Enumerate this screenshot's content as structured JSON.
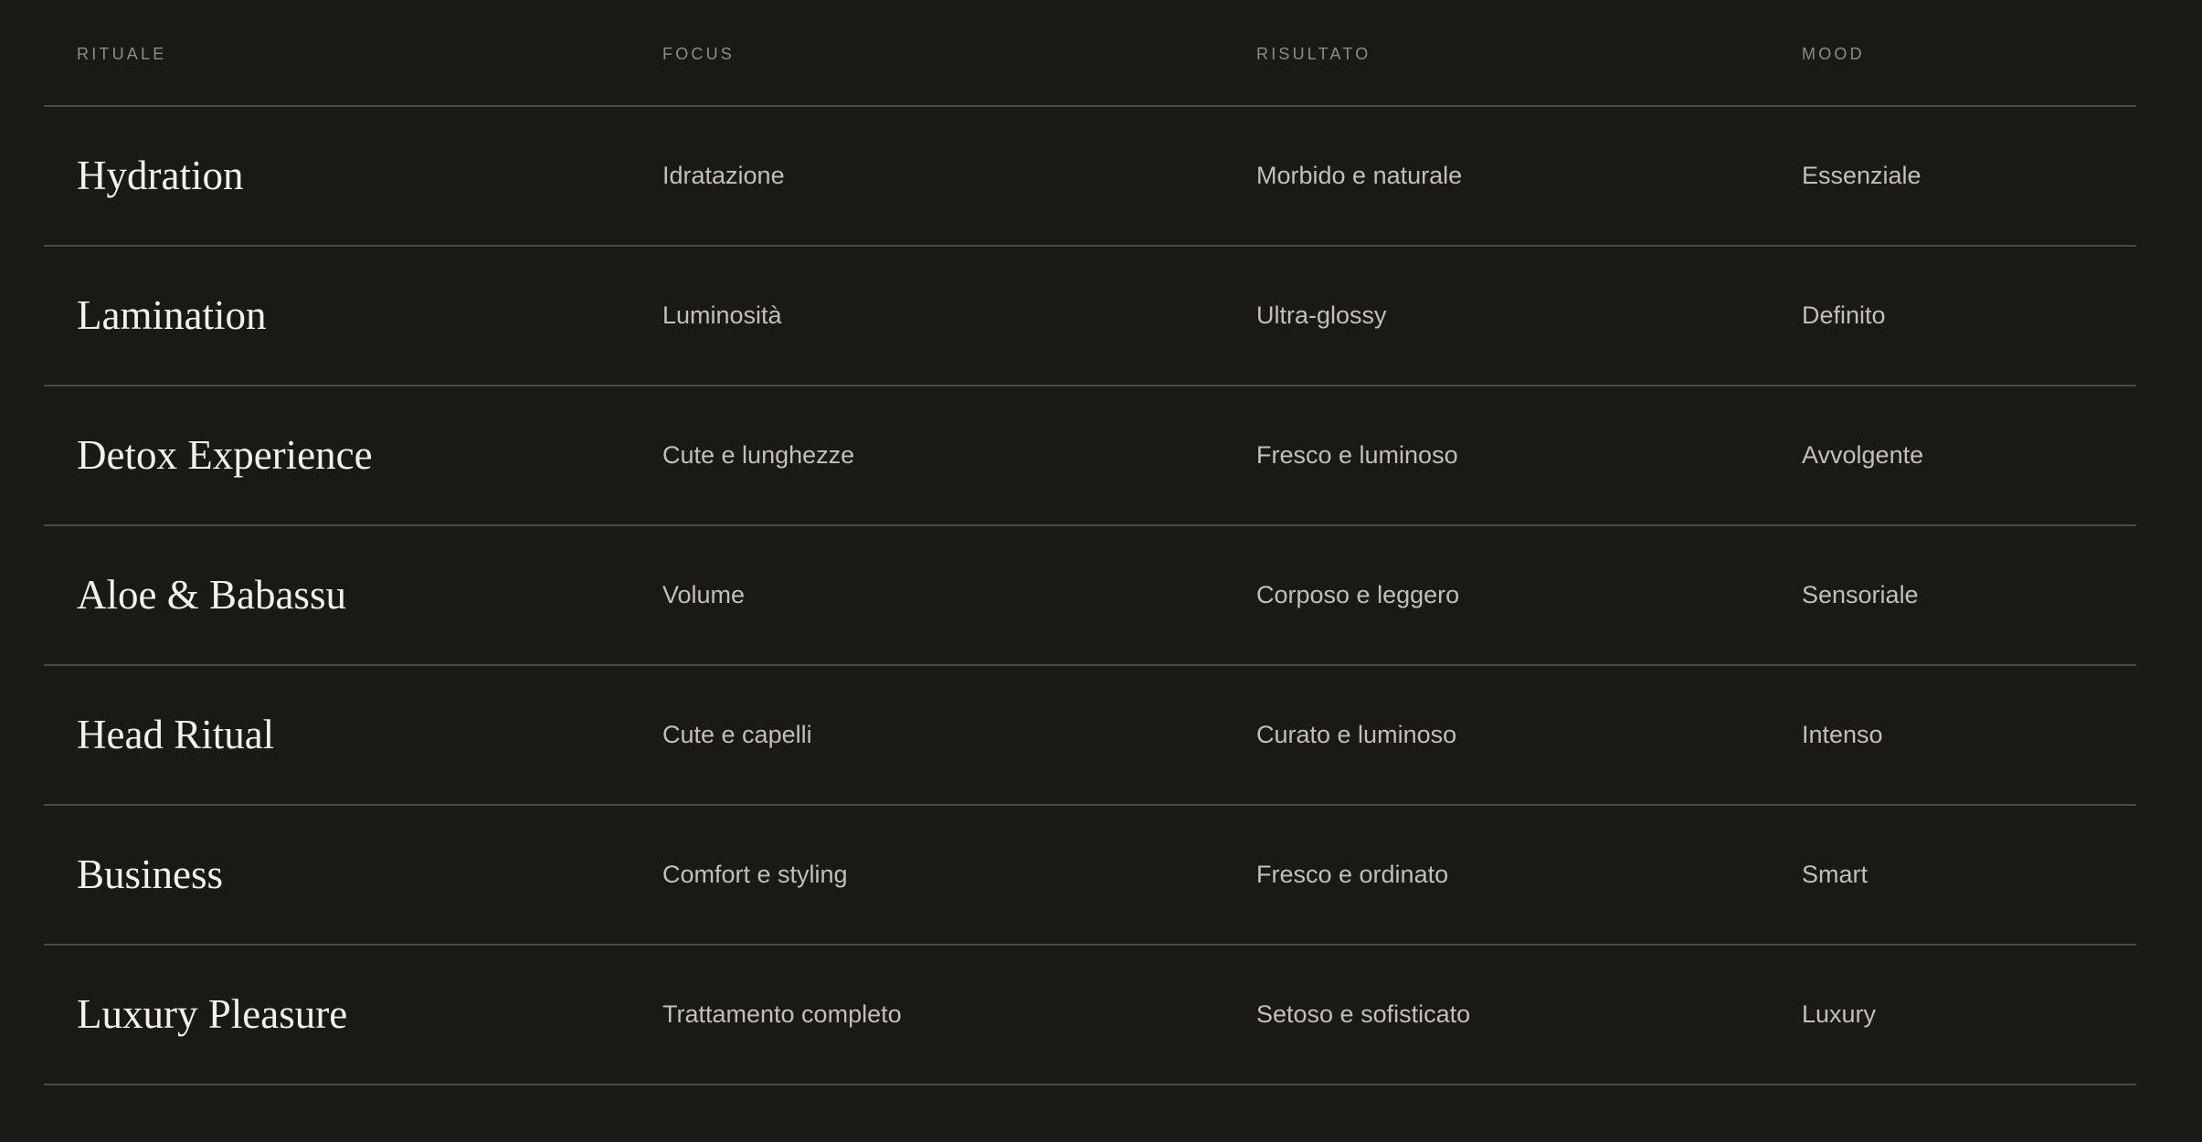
{
  "table": {
    "headers": {
      "ritual": "RITUALE",
      "focus": "FOCUS",
      "result": "RISULTATO",
      "mood": "MOOD"
    },
    "rows": [
      {
        "ritual": "Hydration",
        "focus": "Idratazione",
        "result": "Morbido e naturale",
        "mood": "Essenziale"
      },
      {
        "ritual": "Lamination",
        "focus": "Luminosità",
        "result": "Ultra-glossy",
        "mood": "Definito"
      },
      {
        "ritual": "Detox Experience",
        "focus": "Cute e lunghezze",
        "result": "Fresco e luminoso",
        "mood": "Avvolgente"
      },
      {
        "ritual": "Aloe & Babassu",
        "focus": "Volume",
        "result": "Corposo e leggero",
        "mood": "Sensoriale"
      },
      {
        "ritual": "Head Ritual",
        "focus": "Cute e capelli",
        "result": "Curato e luminoso",
        "mood": "Intenso"
      },
      {
        "ritual": "Business",
        "focus": "Comfort e styling",
        "result": "Fresco e ordinato",
        "mood": "Smart"
      },
      {
        "ritual": "Luxury Pleasure",
        "focus": "Trattamento completo",
        "result": "Setoso e sofisticato",
        "mood": "Luxury"
      }
    ]
  },
  "colors": {
    "background": "#1a1916",
    "divider": "#4a4945",
    "heading_text": "#8f8c85",
    "ritual_text": "#f4f1ea",
    "value_text": "#c3bfb6"
  }
}
